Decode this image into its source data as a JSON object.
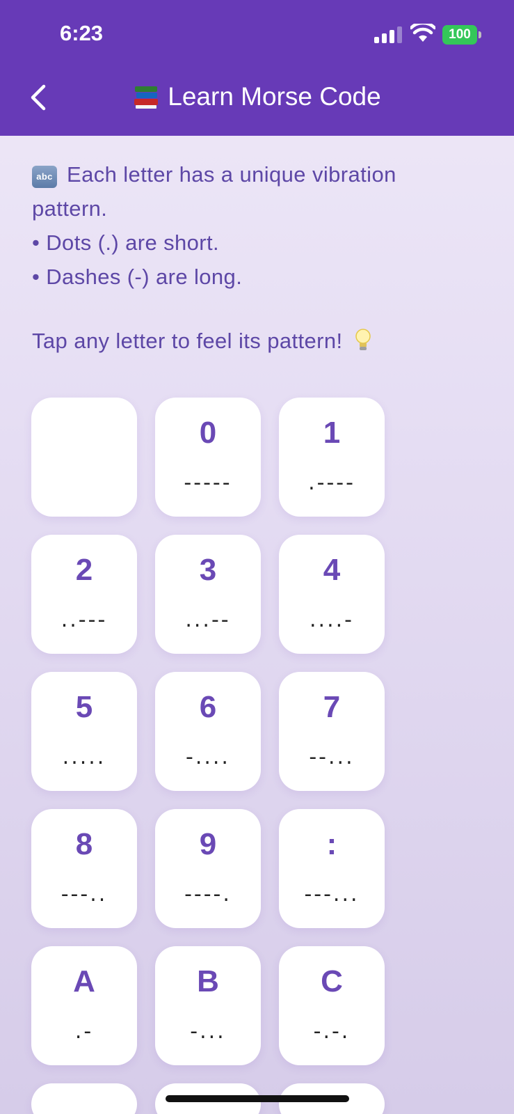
{
  "status_bar": {
    "time": "6:23",
    "battery": "100"
  },
  "nav": {
    "title": "Learn Morse Code",
    "title_icon": "books-icon",
    "back_icon": "chevron-left-icon"
  },
  "intro": {
    "line1": "Each letter has a unique vibration",
    "line2": "pattern.",
    "line3": "• Dots (.) are short.",
    "line4": "• Dashes (-) are long.",
    "icon": "abc-icon"
  },
  "tap_hint": "Tap any letter to feel its pattern!",
  "tap_hint_icon": "light-bulb-icon",
  "keys": [
    {
      "char": " ",
      "code": ""
    },
    {
      "char": "0",
      "code": "-----"
    },
    {
      "char": "1",
      "code": ".----"
    },
    {
      "char": "2",
      "code": "..---"
    },
    {
      "char": "3",
      "code": "...--"
    },
    {
      "char": "4",
      "code": "....-"
    },
    {
      "char": "5",
      "code": "....."
    },
    {
      "char": "6",
      "code": "-...."
    },
    {
      "char": "7",
      "code": "--..."
    },
    {
      "char": "8",
      "code": "---.."
    },
    {
      "char": "9",
      "code": "----."
    },
    {
      "char": ":",
      "code": "---..."
    },
    {
      "char": "A",
      "code": ".-"
    },
    {
      "char": "B",
      "code": "-..."
    },
    {
      "char": "C",
      "code": "-.-."
    }
  ],
  "colors": {
    "header": "#673ab7",
    "accent": "#6a49b5",
    "battery": "#34c759"
  }
}
